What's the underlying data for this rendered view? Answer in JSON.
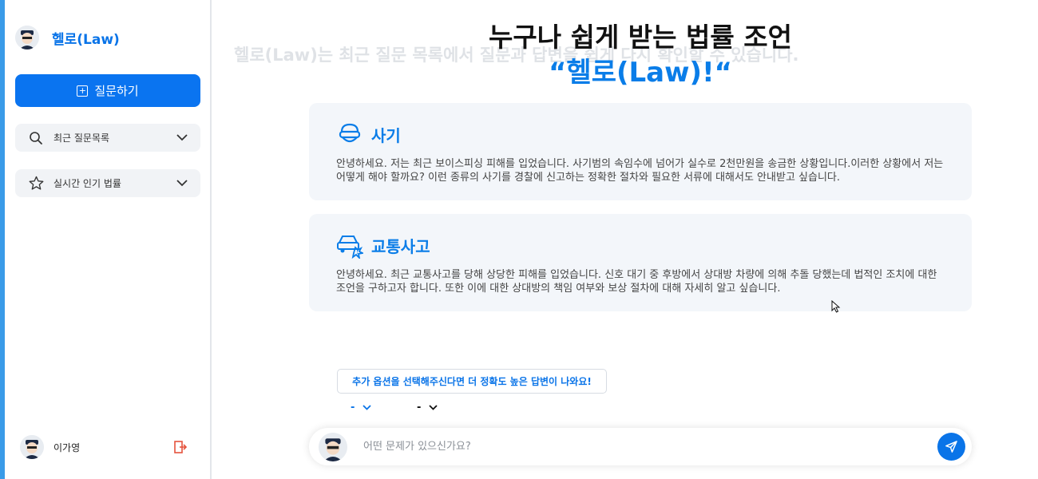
{
  "app": {
    "brand_name": "헬로(Law)",
    "accent_color": "#0a74e8"
  },
  "sidebar": {
    "ask_button": "질문하기",
    "menus": [
      {
        "label": "최근 질문목록",
        "icon": "search-icon"
      },
      {
        "label": "실시간 인기 법률",
        "icon": "star-icon"
      }
    ],
    "user_name": "이가영",
    "logout_icon": "logout-icon"
  },
  "main": {
    "faded_intro": "헬로(Law)는 최근 질문 목록에서 질문과 답변을 쉽게 다시 확인할 수 있습니다.",
    "headline_line1": "누구나 쉽게 받는 법률 조언",
    "headline_line2": "“헬로(Law)!“",
    "cards": [
      {
        "title": "사기",
        "icon": "masked-thief-icon",
        "text": "안녕하세요. 저는 최근 보이스피싱 피해를 입었습니다. 사기범의 속임수에 넘어가 실수로 2천만원을 송금한 상황입니다.이러한 상황에서 저는 어떻게 해야 할까요? 이런 종류의 사기를 경찰에 신고하는 정확한 절차와 필요한 서류에 대해서도 안내받고 싶습니다."
      },
      {
        "title": "교통사고",
        "icon": "car-accident-icon",
        "text": "안녕하세요. 최근 교통사고를 당해 상당한 피해를 입었습니다. 신호 대기 중 후방에서 상대방 차량에 의해 추돌 당했는데 법적인 조치에 대한 조언을 구하고자 합니다. 또한 이에 대한 상대방의 책임 여부와 보상 절차에 대해 자세히 알고 싶습니다."
      }
    ],
    "hint_button": "추가 옵션을 선택해주신다면 더 정확도 높은 답변이 나와요!",
    "option1_value": "-",
    "option2_value": "-",
    "input_placeholder": "어떤 문제가 있으신가요?"
  }
}
